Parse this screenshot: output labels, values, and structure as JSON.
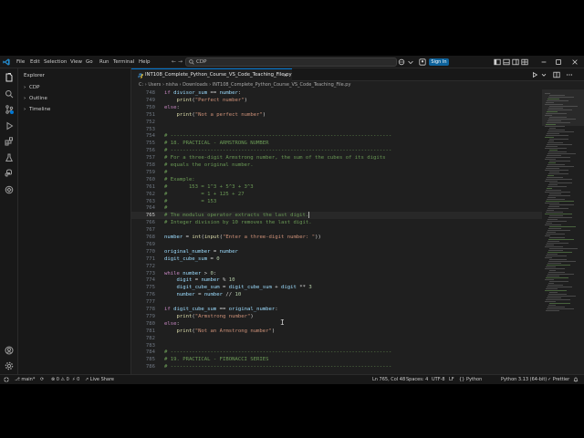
{
  "titlebar": {
    "menus": [
      "File",
      "Edit",
      "Selection",
      "View",
      "Go",
      "Run",
      "Terminal",
      "Help"
    ],
    "back": "←",
    "forward": "→",
    "search_text": "CDP",
    "signin_label": "Sign In"
  },
  "sidebar": {
    "title": "Explorer",
    "sections": [
      {
        "chevron": "›",
        "label": "CDP"
      },
      {
        "chevron": "›",
        "label": "Outline"
      },
      {
        "chevron": "›",
        "label": "Timeline"
      }
    ]
  },
  "tab": {
    "label": "INT108_Complete_Python_Course_VS_Code_Teaching_File.py",
    "close": "×"
  },
  "breadcrumb": {
    "text": "C: › Users › nisha › Downloads › INT108_Complete_Python_Course_VS_Code_Teaching_File.py"
  },
  "editor": {
    "lines": [
      {
        "n": "748",
        "t": "if divisor_sum == number:"
      },
      {
        "n": "749",
        "t": "    print(\"Perfect number\")"
      },
      {
        "n": "750",
        "t": "else:"
      },
      {
        "n": "751",
        "t": "    print(\"Not a perfect number\")"
      },
      {
        "n": "752",
        "t": ""
      },
      {
        "n": "753",
        "t": ""
      },
      {
        "n": "754",
        "t": "# ------------------------------------------------------------------------"
      },
      {
        "n": "755",
        "t": "# 18. PRACTICAL - ARMSTRONG NUMBER"
      },
      {
        "n": "756",
        "t": "# ------------------------------------------------------------------------"
      },
      {
        "n": "757",
        "t": "# For a three-digit Armstrong number, the sum of the cubes of its digits"
      },
      {
        "n": "758",
        "t": "# equals the original number."
      },
      {
        "n": "759",
        "t": "#"
      },
      {
        "n": "760",
        "t": "# Example:"
      },
      {
        "n": "761",
        "t": "#       153 = 1^3 + 5^3 + 3^3"
      },
      {
        "n": "762",
        "t": "#           = 1 + 125 + 27"
      },
      {
        "n": "763",
        "t": "#           = 153"
      },
      {
        "n": "764",
        "t": "#"
      },
      {
        "n": "765",
        "t": "# The modulus operator extracts the last digit."
      },
      {
        "n": "766",
        "t": "# Integer division by 10 removes the last digit."
      },
      {
        "n": "767",
        "t": ""
      },
      {
        "n": "768",
        "t": "number = int(input(\"Enter a three-digit number: \"))"
      },
      {
        "n": "769",
        "t": ""
      },
      {
        "n": "770",
        "t": "original_number = number"
      },
      {
        "n": "771",
        "t": "digit_cube_sum = 0"
      },
      {
        "n": "772",
        "t": ""
      },
      {
        "n": "773",
        "t": "while number > 0:"
      },
      {
        "n": "774",
        "t": "    digit = number % 10"
      },
      {
        "n": "775",
        "t": "    digit_cube_sum = digit_cube_sum + digit ** 3"
      },
      {
        "n": "776",
        "t": "    number = number // 10"
      },
      {
        "n": "777",
        "t": ""
      },
      {
        "n": "778",
        "t": "if digit_cube_sum == original_number:"
      },
      {
        "n": "779",
        "t": "    print(\"Armstrong number\")"
      },
      {
        "n": "780",
        "t": "else:"
      },
      {
        "n": "781",
        "t": "    print(\"Not an Armstrong number\")"
      },
      {
        "n": "782",
        "t": ""
      },
      {
        "n": "783",
        "t": ""
      },
      {
        "n": "784",
        "t": "# ------------------------------------------------------------------------"
      },
      {
        "n": "785",
        "t": "# 19. PRACTICAL - FIBONACCI SERIES"
      },
      {
        "n": "786",
        "t": "# ------------------------------------------------------------------------"
      }
    ],
    "current_line": "765"
  },
  "statusbar": {
    "branch": "main*",
    "problems": "⊗ 0  ⚠ 0",
    "ports": "0",
    "live_share": "Live Share",
    "position": "Ln 765, Col 48",
    "spaces": "Spaces: 4",
    "encoding": "UTF-8",
    "eol": "LF",
    "language": "Python",
    "interpreter": "Python 3.13 (64-bit)",
    "prettier": "✓ Prettier"
  },
  "colors": {
    "accent": "#0078d4",
    "signin": "#0e639c",
    "keyword": "#c586c0",
    "function": "#dcdcaa",
    "string": "#ce9178",
    "comment": "#6a9955"
  }
}
